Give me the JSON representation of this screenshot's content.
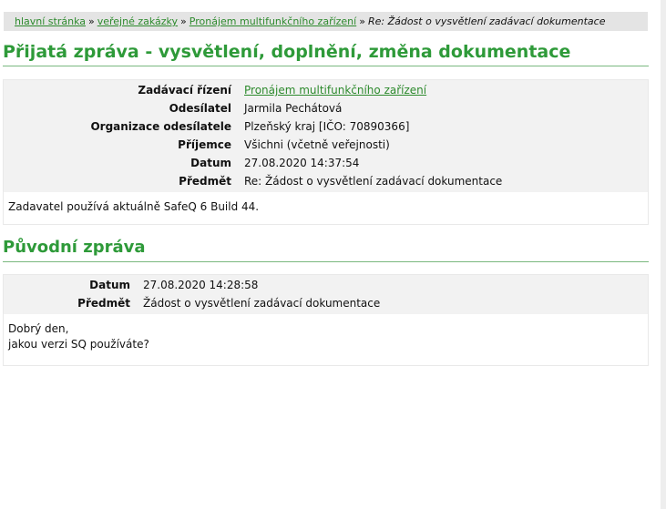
{
  "breadcrumb": {
    "home": "hlavní stránka",
    "tenders": "veřejné zakázky",
    "tender": "Pronájem multifunkčního zařízení",
    "current": "Re: Žádost o vysvětlení zadávací dokumentace"
  },
  "page_title": "Přijatá zpráva - vysvětlení, doplnění, změna dokumentace",
  "received": {
    "fields": [
      {
        "label": "Zadávací řízení",
        "value": "Pronájem multifunkčního zařízení"
      },
      {
        "label": "Odesílatel",
        "value": "Jarmila Pechátová"
      },
      {
        "label": "Organizace odesílatele",
        "value": "Plzeňský kraj [IČO: 70890366]"
      },
      {
        "label": "Příjemce",
        "value": "Všichni (včetně veřejnosti)"
      },
      {
        "label": "Datum",
        "value": "27.08.2020 14:37:54"
      },
      {
        "label": "Předmět",
        "value": "Re: Žádost o vysvětlení zadávací dokumentace"
      }
    ],
    "body": "Zadavatel používá aktuálně SafeQ 6 Build 44."
  },
  "original_title": "Původní zpráva",
  "original": {
    "fields": [
      {
        "label": "Datum",
        "value": "27.08.2020 14:28:58"
      },
      {
        "label": "Předmět",
        "value": "Žádost o vysvětlení zadávací dokumentace"
      }
    ],
    "body_line1": "Dobrý den,",
    "body_line2": "jakou verzi SQ používáte?"
  }
}
